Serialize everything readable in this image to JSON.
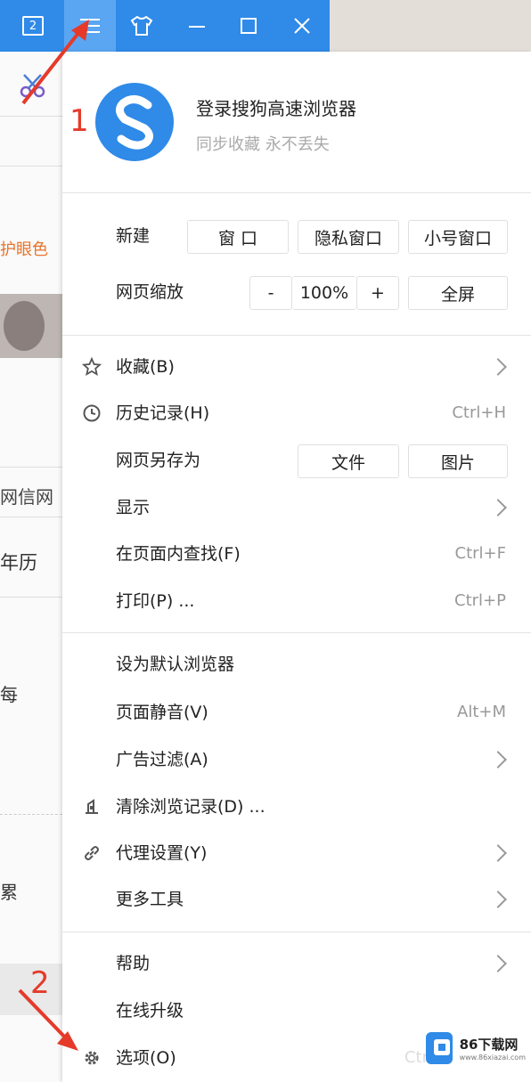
{
  "topbar": {
    "tab_count": "2",
    "buttons": [
      "tab-count",
      "menu",
      "skin",
      "minimize",
      "maximize",
      "close"
    ]
  },
  "left_page": {
    "rows": [
      "护眼色",
      "网信网",
      "年历",
      "每",
      "累"
    ]
  },
  "login": {
    "title": "登录搜狗高速浏览器",
    "subtitle": "同步收藏 永不丢失"
  },
  "new_section": {
    "label": "新建",
    "buttons": [
      "窗 口",
      "隐私窗口",
      "小号窗口"
    ]
  },
  "zoom_section": {
    "label": "网页缩放",
    "minus": "-",
    "value": "100%",
    "plus": "+",
    "fullscreen": "全屏"
  },
  "menu_group1": {
    "favorites": "收藏(B)",
    "history": "历史记录(H)",
    "history_shortcut": "Ctrl+H",
    "save_as": "网页另存为",
    "save_file": "文件",
    "save_image": "图片",
    "display": "显示",
    "find": "在页面内查找(F)",
    "find_shortcut": "Ctrl+F",
    "print": "打印(P) ...",
    "print_shortcut": "Ctrl+P"
  },
  "menu_group2": {
    "default_browser": "设为默认浏览器",
    "mute": "页面静音(V)",
    "mute_shortcut": "Alt+M",
    "ad_filter": "广告过滤(A)",
    "clear_history": "清除浏览记录(D) ...",
    "proxy": "代理设置(Y)",
    "more_tools": "更多工具"
  },
  "menu_group3": {
    "help": "帮助",
    "upgrade": "在线升级",
    "options": "选项(O)",
    "options_shortcut": "Ctrl"
  },
  "annotations": {
    "step1": "1",
    "step2": "2"
  },
  "watermark": {
    "name": "86下载网",
    "url": "www.86xiazai.com"
  },
  "colors": {
    "topbar": "#2f8ae8",
    "active_button": "#5aa6f2",
    "annotation": "#e53a2a",
    "logo_blue": "#2f8ae8"
  }
}
